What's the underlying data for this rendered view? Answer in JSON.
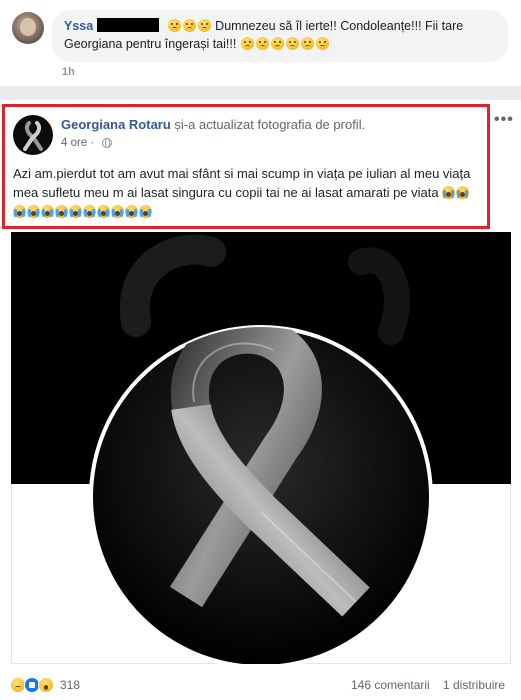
{
  "comment": {
    "author_name": "Yssa",
    "text_line1": "Dumnezeu să îl ierte!! Condoleanțe!!! Fii tare",
    "text_line2": "Georgiana pentru îngerași tai!!!",
    "time": "1h"
  },
  "post": {
    "author_name": "Georgiana Rotaru",
    "action": "și-a actualizat fotografia de profil.",
    "time": "4 ore",
    "privacy_icon": "globe-icon",
    "more_label": "•••",
    "text": "Azi am.pierdut tot am avut mai sfânt si mai scump in viața pe iulian al meu viața mea sufletu meu m ai lasat singura cu copii tai ne ai lasat amarati pe viata",
    "photo_subject": "black-ribbon-icon"
  },
  "footer": {
    "reaction_icons": [
      "sad-reaction-icon",
      "like-reaction-icon",
      "wow-reaction-icon"
    ],
    "reaction_count": "318",
    "comments": "146 comentarii",
    "shares": "1 distribuire"
  },
  "colors": {
    "highlight_border": "#e0222b",
    "link_blue": "#365899",
    "like_blue": "#1877f2",
    "page_bg": "#e9ebee"
  }
}
